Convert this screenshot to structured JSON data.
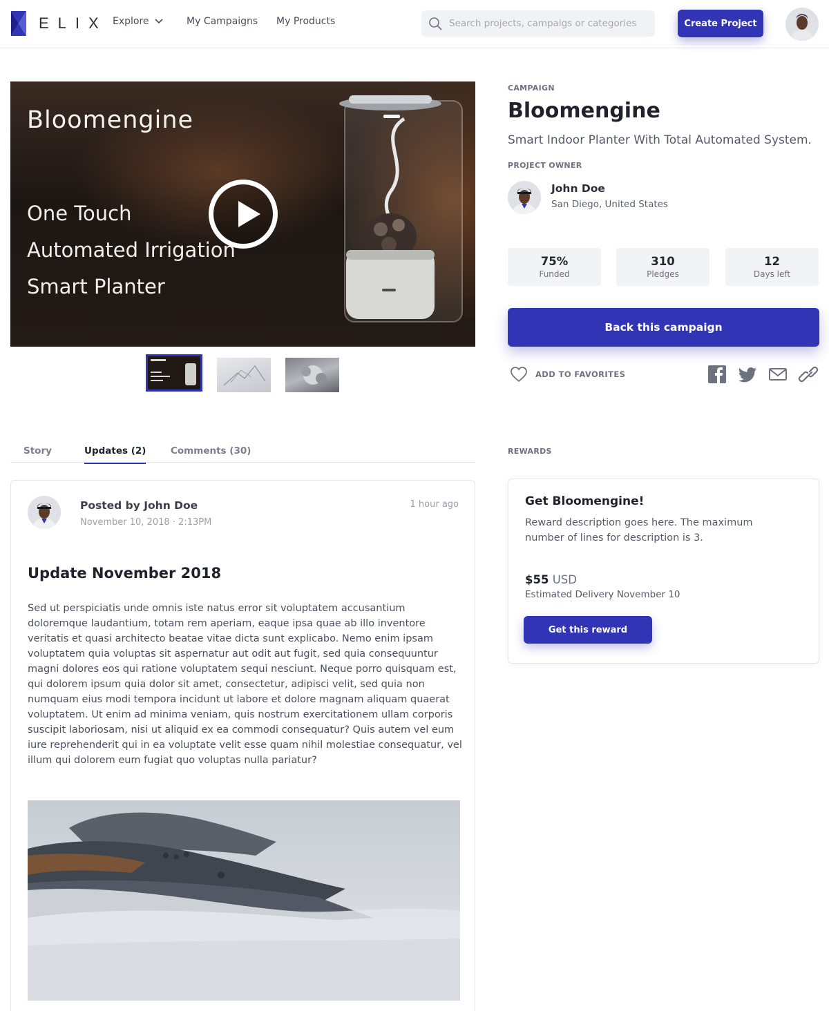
{
  "header": {
    "logo_text": "ELIX",
    "nav": {
      "explore": "Explore",
      "my_campaigns": "My Campaigns",
      "my_products": "My Products"
    },
    "search_placeholder": "Search projects, campaigs or categories",
    "create_project": "Create Project"
  },
  "media": {
    "brand": "Bloomengine",
    "line1": "One Touch",
    "line2": "Automated Irrigation",
    "line3": "Smart Planter"
  },
  "campaign": {
    "label": "CAMPAIGN",
    "title": "Bloomengine",
    "subtitle": "Smart Indoor Planter With Total Automated System.",
    "owner_label": "PROJECT OWNER",
    "owner_name": "John Doe",
    "owner_location": "San Diego, United States",
    "stats": [
      {
        "value": "75%",
        "label": "Funded"
      },
      {
        "value": "310",
        "label": "Pledges"
      },
      {
        "value": "12",
        "label": "Days left"
      }
    ],
    "back_button": "Back this campaign",
    "favorites": "ADD TO FAVORITES"
  },
  "tabs": {
    "story": "Story",
    "updates": "Updates (2)",
    "comments": "Comments (30)"
  },
  "update": {
    "posted_by": "Posted by John Doe",
    "date": "November 10, 2018 · 2:13PM",
    "ago": "1 hour ago",
    "title": "Update November 2018",
    "body": "Sed ut perspiciatis unde omnis iste natus error sit voluptatem accusantium doloremque laudantium, totam rem aperiam, eaque ipsa quae ab illo inventore veritatis et quasi architecto beatae vitae dicta sunt explicabo. Nemo enim ipsam voluptatem quia voluptas sit aspernatur aut odit aut fugit, sed quia consequuntur magni dolores eos qui ratione voluptatem sequi nesciunt. Neque porro quisquam est, qui dolorem ipsum quia dolor sit amet, consectetur, adipisci velit, sed quia non numquam eius modi tempora incidunt ut labore et dolore magnam aliquam quaerat voluptatem. Ut enim ad minima veniam, quis nostrum exercitationem ullam corporis suscipit laboriosam, nisi ut aliquid ex ea commodi consequatur? Quis autem vel eum iure reprehenderit qui in ea voluptate velit esse quam nihil molestiae consequatur, vel illum qui dolorem eum fugiat quo voluptas nulla pariatur?"
  },
  "rewards": {
    "label": "REWARDS",
    "title": "Get Bloomengine!",
    "description": "Reward description goes here. The maximum number of lines for description is 3.",
    "price": "$55",
    "currency": "USD",
    "delivery": "Estimated Delivery November 10",
    "button": "Get this reward"
  },
  "colors": {
    "accent": "#3234b6",
    "text_dark": "#1f222a",
    "text_muted": "#6e7280"
  },
  "icons": [
    "logo-icon",
    "chevron-down-icon",
    "search-icon",
    "play-icon",
    "heart-icon",
    "facebook-icon",
    "twitter-icon",
    "mail-icon",
    "link-icon"
  ]
}
